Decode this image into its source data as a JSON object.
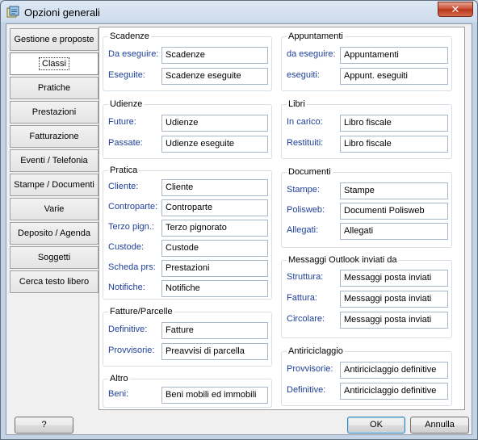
{
  "window": {
    "title": "Opzioni generali",
    "close_glyph": "✕"
  },
  "tabs": [
    {
      "label": "Gestione e proposte"
    },
    {
      "label": "Classi",
      "active": true
    },
    {
      "label": "Pratiche"
    },
    {
      "label": "Prestazioni"
    },
    {
      "label": "Fatturazione"
    },
    {
      "label": "Eventi / Telefonia"
    },
    {
      "label": "Stampe / Documenti"
    },
    {
      "label": "Varie"
    },
    {
      "label": "Deposito / Agenda"
    },
    {
      "label": "Soggetti"
    },
    {
      "label": "Cerca testo libero"
    }
  ],
  "groups": {
    "scadenze": {
      "title": "Scadenze",
      "rows": [
        {
          "label": "Da eseguire:",
          "value": "Scadenze"
        },
        {
          "label": "Eseguite:",
          "value": "Scadenze eseguite"
        }
      ]
    },
    "udienze": {
      "title": "Udienze",
      "rows": [
        {
          "label": "Future:",
          "value": "Udienze"
        },
        {
          "label": "Passate:",
          "value": "Udienze eseguite"
        }
      ]
    },
    "pratica": {
      "title": "Pratica",
      "rows": [
        {
          "label": "Cliente:",
          "value": "Cliente"
        },
        {
          "label": "Controparte:",
          "value": "Controparte"
        },
        {
          "label": "Terzo pign.:",
          "value": "Terzo pignorato"
        },
        {
          "label": "Custode:",
          "value": "Custode"
        },
        {
          "label": "Scheda prs:",
          "value": "Prestazioni"
        },
        {
          "label": "Notifiche:",
          "value": "Notifiche"
        }
      ]
    },
    "fatture": {
      "title": "Fatture/Parcelle",
      "rows": [
        {
          "label": "Definitive:",
          "value": "Fatture"
        },
        {
          "label": "Provvisorie:",
          "value": "Preavvisi di parcella"
        }
      ]
    },
    "altro": {
      "title": "Altro",
      "rows": [
        {
          "label": "Beni:",
          "value": "Beni mobili ed immobili"
        }
      ]
    },
    "appuntamenti": {
      "title": "Appuntamenti",
      "rows": [
        {
          "label": "da eseguire:",
          "value": "Appuntamenti"
        },
        {
          "label": "eseguiti:",
          "value": "Appunt. eseguiti"
        }
      ]
    },
    "libri": {
      "title": "Libri",
      "rows": [
        {
          "label": "In carico:",
          "value": "Libro fiscale"
        },
        {
          "label": "Restituiti:",
          "value": "Libro fiscale"
        }
      ]
    },
    "documenti": {
      "title": "Documenti",
      "rows": [
        {
          "label": "Stampe:",
          "value": "Stampe"
        },
        {
          "label": "Polisweb:",
          "value": "Documenti Polisweb"
        },
        {
          "label": "Allegati:",
          "value": "Allegati"
        }
      ]
    },
    "outlook": {
      "title": "Messaggi Outlook inviati da",
      "rows": [
        {
          "label": "Struttura:",
          "value": "Messaggi posta inviati"
        },
        {
          "label": "Fattura:",
          "value": "Messaggi posta inviati"
        },
        {
          "label": "Circolare:",
          "value": "Messaggi posta inviati"
        }
      ]
    },
    "antiriciclaggio": {
      "title": "Antiriciclaggio",
      "rows": [
        {
          "label": "Provvisorie:",
          "value": "Antiriciclaggio definitive"
        },
        {
          "label": "Definitive:",
          "value": "Antiriciclaggio definitive"
        }
      ]
    }
  },
  "buttons": {
    "help": "?",
    "ok": "OK",
    "cancel": "Annulla"
  }
}
